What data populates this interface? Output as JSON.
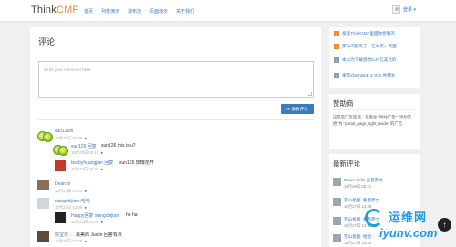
{
  "header": {
    "brand_part1": "Think",
    "brand_part2": "CMF",
    "nav": [
      "首页",
      "列表演示",
      "瀑布流",
      "页面演示",
      "关于我们"
    ],
    "login_label": "登录 ▾"
  },
  "main": {
    "title": "评论",
    "comment_placeholder": "Write your comment here",
    "submit_label": "发表评论",
    "comments": [
      {
        "name": "sun126hi",
        "text": "",
        "time": "10月23日 00:09"
      },
      {
        "name": "sun126 回复",
        "text": "sun126 this is u?",
        "time": "10月23日 00:10"
      },
      {
        "name": "testbyhuangjian 回复",
        "text": "sun126 玫瑰花开",
        "time": "10月23日 10:45"
      },
      {
        "name": "Dean:hi",
        "text": "",
        "time": "10月27日 07:22"
      },
      {
        "name": "xiangchijiam:哈哈",
        "text": "",
        "time": "10月27日 13:39"
      },
      {
        "name": "Happy回复 xiangchijiam",
        "text": "he ha",
        "time": "10月23日 13:09"
      },
      {
        "name": "陈宝尔 : ",
        "text": "最美的 Justin 回答有点",
        "time": "10月25日 17:55"
      }
    ],
    "reply_label": "回复"
  },
  "sidebar": {
    "hot_posts": [
      {
        "num": "2",
        "title": "发现ThinkCMF里面你想看的",
        "color": "#f08c26"
      },
      {
        "num": "3",
        "title": "那么问题来了，在本来，页面",
        "color": "#f08c26"
      },
      {
        "num": "4",
        "title": "本以为下载感觉5.42亿美元的",
        "color": "#8d99a6"
      },
      {
        "num": "5",
        "title": "果奔@pRoBIE 3 'iOS 他都太",
        "color": "#8d99a6"
      }
    ],
    "sponsor_title": "赞助商",
    "sponsor_text": "这是是广告区域，在后台 \"网站广告\" \"添加其他\"为 \"portal_page_right_aside\" 的广告",
    "latest_title": "最新评论",
    "latest_comments": [
      {
        "who": "Dean: hello 查看原文",
        "when": "10月29日 08:21"
      },
      {
        "who": "雪山极酸: 看着原文",
        "when": "10月27日 13:39"
      },
      {
        "who": "雪山极酸: 看看原文",
        "when": "10月27日 13:39"
      },
      {
        "who": "雪山极酸: 哈哈",
        "when": "10月27日 13:45"
      }
    ]
  },
  "watermark": {
    "cn": "运维网",
    "en": "iyunv.com"
  }
}
